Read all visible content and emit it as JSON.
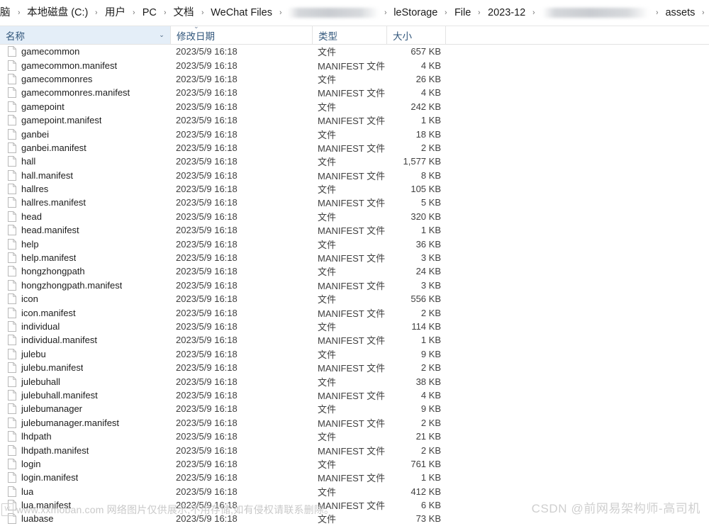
{
  "window": {
    "title": "assets"
  },
  "breadcrumb": {
    "separator": "›",
    "items": [
      {
        "label": "脑",
        "blurred": false
      },
      {
        "label": "本地磁盘 (C:)",
        "blurred": false
      },
      {
        "label": "用户",
        "blurred": false
      },
      {
        "label": "PC",
        "blurred": false
      },
      {
        "label": "文档",
        "blurred": false
      },
      {
        "label": "WeChat Files",
        "blurred": false
      },
      {
        "label": "",
        "blurred": true
      },
      {
        "label": "leStorage",
        "blurred": false
      },
      {
        "label": "File",
        "blurred": false
      },
      {
        "label": "2023-12",
        "blurred": false
      },
      {
        "label": "",
        "blurred": true
      },
      {
        "label": "assets",
        "blurred": false
      }
    ]
  },
  "columns": {
    "name": "名称",
    "date_modified": "修改日期",
    "type": "类型",
    "size": "大小",
    "sorted_column": "修改日期",
    "sort_indicator": "⌄",
    "filter_chevron": "⌄",
    "selected_header": "名称",
    "selected_header_bg": "#e4eef8"
  },
  "file_types": {
    "file": "文件",
    "manifest": "MANIFEST 文件"
  },
  "rows": [
    {
      "name": "gamecommon",
      "date": "2023/5/9 16:18",
      "type": "文件",
      "size": "657 KB"
    },
    {
      "name": "gamecommon.manifest",
      "date": "2023/5/9 16:18",
      "type": "MANIFEST 文件",
      "size": "4 KB"
    },
    {
      "name": "gamecommonres",
      "date": "2023/5/9 16:18",
      "type": "文件",
      "size": "26 KB"
    },
    {
      "name": "gamecommonres.manifest",
      "date": "2023/5/9 16:18",
      "type": "MANIFEST 文件",
      "size": "4 KB"
    },
    {
      "name": "gamepoint",
      "date": "2023/5/9 16:18",
      "type": "文件",
      "size": "242 KB"
    },
    {
      "name": "gamepoint.manifest",
      "date": "2023/5/9 16:18",
      "type": "MANIFEST 文件",
      "size": "1 KB"
    },
    {
      "name": "ganbei",
      "date": "2023/5/9 16:18",
      "type": "文件",
      "size": "18 KB"
    },
    {
      "name": "ganbei.manifest",
      "date": "2023/5/9 16:18",
      "type": "MANIFEST 文件",
      "size": "2 KB"
    },
    {
      "name": "hall",
      "date": "2023/5/9 16:18",
      "type": "文件",
      "size": "1,577 KB"
    },
    {
      "name": "hall.manifest",
      "date": "2023/5/9 16:18",
      "type": "MANIFEST 文件",
      "size": "8 KB"
    },
    {
      "name": "hallres",
      "date": "2023/5/9 16:18",
      "type": "文件",
      "size": "105 KB"
    },
    {
      "name": "hallres.manifest",
      "date": "2023/5/9 16:18",
      "type": "MANIFEST 文件",
      "size": "5 KB"
    },
    {
      "name": "head",
      "date": "2023/5/9 16:18",
      "type": "文件",
      "size": "320 KB"
    },
    {
      "name": "head.manifest",
      "date": "2023/5/9 16:18",
      "type": "MANIFEST 文件",
      "size": "1 KB"
    },
    {
      "name": "help",
      "date": "2023/5/9 16:18",
      "type": "文件",
      "size": "36 KB"
    },
    {
      "name": "help.manifest",
      "date": "2023/5/9 16:18",
      "type": "MANIFEST 文件",
      "size": "3 KB"
    },
    {
      "name": "hongzhongpath",
      "date": "2023/5/9 16:18",
      "type": "文件",
      "size": "24 KB"
    },
    {
      "name": "hongzhongpath.manifest",
      "date": "2023/5/9 16:18",
      "type": "MANIFEST 文件",
      "size": "3 KB"
    },
    {
      "name": "icon",
      "date": "2023/5/9 16:18",
      "type": "文件",
      "size": "556 KB"
    },
    {
      "name": "icon.manifest",
      "date": "2023/5/9 16:18",
      "type": "MANIFEST 文件",
      "size": "2 KB"
    },
    {
      "name": "individual",
      "date": "2023/5/9 16:18",
      "type": "文件",
      "size": "114 KB"
    },
    {
      "name": "individual.manifest",
      "date": "2023/5/9 16:18",
      "type": "MANIFEST 文件",
      "size": "1 KB"
    },
    {
      "name": "julebu",
      "date": "2023/5/9 16:18",
      "type": "文件",
      "size": "9 KB"
    },
    {
      "name": "julebu.manifest",
      "date": "2023/5/9 16:18",
      "type": "MANIFEST 文件",
      "size": "2 KB"
    },
    {
      "name": "julebuhall",
      "date": "2023/5/9 16:18",
      "type": "文件",
      "size": "38 KB"
    },
    {
      "name": "julebuhall.manifest",
      "date": "2023/5/9 16:18",
      "type": "MANIFEST 文件",
      "size": "4 KB"
    },
    {
      "name": "julebumanager",
      "date": "2023/5/9 16:18",
      "type": "文件",
      "size": "9 KB"
    },
    {
      "name": "julebumanager.manifest",
      "date": "2023/5/9 16:18",
      "type": "MANIFEST 文件",
      "size": "2 KB"
    },
    {
      "name": "lhdpath",
      "date": "2023/5/9 16:18",
      "type": "文件",
      "size": "21 KB"
    },
    {
      "name": "lhdpath.manifest",
      "date": "2023/5/9 16:18",
      "type": "MANIFEST 文件",
      "size": "2 KB"
    },
    {
      "name": "login",
      "date": "2023/5/9 16:18",
      "type": "文件",
      "size": "761 KB"
    },
    {
      "name": "login.manifest",
      "date": "2023/5/9 16:18",
      "type": "MANIFEST 文件",
      "size": "1 KB"
    },
    {
      "name": "lua",
      "date": "2023/5/9 16:18",
      "type": "文件",
      "size": "412 KB"
    },
    {
      "name": "lua.manifest",
      "date": "2023/5/9 16:18",
      "type": "MANIFEST 文件",
      "size": "6 KB"
    },
    {
      "name": "luabase",
      "date": "2023/5/9 16:18",
      "type": "文件",
      "size": "73 KB"
    }
  ],
  "watermarks": {
    "bottom_left_logo": "W",
    "bottom_left": "www.xxmoban.com 网络图片仅供展示,不用存储,如有侵权请联系删除。",
    "bottom_right": "CSDN @前网易架构师-高司机"
  }
}
